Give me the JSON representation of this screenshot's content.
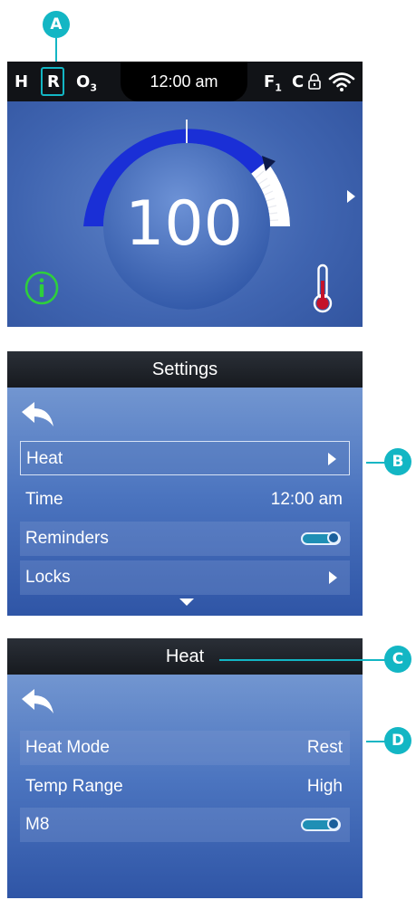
{
  "callouts": {
    "a": "A",
    "b": "B",
    "c": "C",
    "d": "D"
  },
  "main_screen": {
    "status": {
      "h": "H",
      "r": "R",
      "o3": "O",
      "o3_sub": "3",
      "time": "12:00 am",
      "f1": "F",
      "f1_sub": "1",
      "c": "C"
    },
    "icons": {
      "lock": "lock-icon",
      "wifi": "wifi-icon",
      "info": "info-icon",
      "thermometer": "thermometer-icon",
      "next": "chevron-right-icon"
    },
    "temperature": "100",
    "colors": {
      "gauge_fill": "#1a2fd6",
      "gauge_rest": "#ffffff",
      "info_ring": "#2ecf3c",
      "thermo_bulb": "#c4132a"
    }
  },
  "settings_panel": {
    "title": "Settings",
    "items": [
      {
        "label": "Heat",
        "value": "",
        "control": "arrow"
      },
      {
        "label": "Time",
        "value": "12:00 am",
        "control": "value"
      },
      {
        "label": "Reminders",
        "value": "",
        "control": "toggle"
      },
      {
        "label": "Locks",
        "value": "",
        "control": "arrow"
      }
    ]
  },
  "heat_panel": {
    "title": "Heat",
    "items": [
      {
        "label": "Heat Mode",
        "value": "Rest"
      },
      {
        "label": "Temp Range",
        "value": "High"
      },
      {
        "label": "M8",
        "value": "",
        "control": "toggle"
      }
    ]
  }
}
